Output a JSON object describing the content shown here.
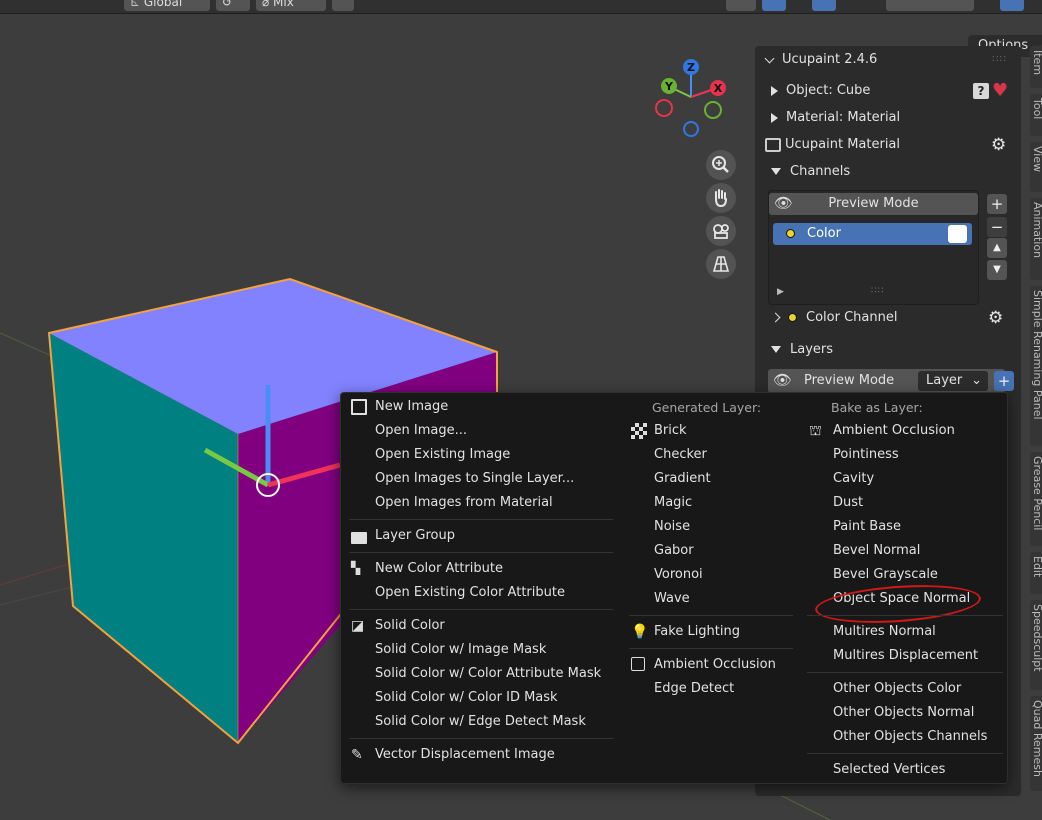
{
  "header": {
    "transform_orientation": "Global",
    "snap_mode": "Mix"
  },
  "viewport": {
    "options_label": "Options",
    "gizmo_axes": [
      "Z",
      "Y",
      "X"
    ]
  },
  "npanel": {
    "title": "Ucupaint 2.4.6",
    "object_label": "Object: Cube",
    "material_label": "Material: Material",
    "ucupaint_material_label": "Ucupaint Material",
    "channels_label": "Channels",
    "preview_mode_label": "Preview Mode",
    "channel_item_label": "Color",
    "color_channel_label": "Color Channel",
    "layers_label": "Layers",
    "layers_preview_mode_label": "Preview Mode",
    "layer_dropdown_value": "Layer"
  },
  "side_tabs": [
    "Item",
    "Tool",
    "View",
    "Animation",
    "Simple Renaming Panel",
    "Grease Pencil",
    "Edit",
    "Speedsculpt",
    "Quad Remesh"
  ],
  "menu": {
    "column1": {
      "group1": [
        "New Image",
        "Open Image...",
        "Open Existing Image",
        "Open Images to Single Layer...",
        "Open Images from Material"
      ],
      "group2": [
        "Layer Group"
      ],
      "group3": [
        "New Color Attribute",
        "Open Existing Color Attribute"
      ],
      "group4": [
        "Solid Color",
        "Solid Color w/ Image Mask",
        "Solid Color w/ Color Attribute Mask",
        "Solid Color w/ Color ID Mask",
        "Solid Color w/ Edge Detect Mask"
      ],
      "group5": [
        "Vector Displacement Image"
      ]
    },
    "column2": {
      "header": "Generated Layer:",
      "items": [
        "Brick",
        "Checker",
        "Gradient",
        "Magic",
        "Noise",
        "Gabor",
        "Voronoi",
        "Wave"
      ],
      "group2": [
        "Fake Lighting"
      ],
      "group3": [
        "Ambient Occlusion",
        "Edge Detect"
      ]
    },
    "column3": {
      "header": "Bake as Layer:",
      "items": [
        "Ambient Occlusion",
        "Pointiness",
        "Cavity",
        "Dust",
        "Paint Base",
        "Bevel Normal",
        "Bevel Grayscale",
        "Object Space Normal"
      ],
      "group2": [
        "Multires Normal",
        "Multires Displacement"
      ],
      "group3": [
        "Other Objects Color",
        "Other Objects Normal",
        "Other Objects Channels"
      ],
      "group4": [
        "Selected Vertices"
      ]
    }
  },
  "colors": {
    "cube_top": "#8282ff",
    "cube_left": "#008080",
    "cube_front": "#800080",
    "selection_outline": "#f4a13e",
    "accent_blue": "#4772b3",
    "annotation_red": "#d01818"
  }
}
